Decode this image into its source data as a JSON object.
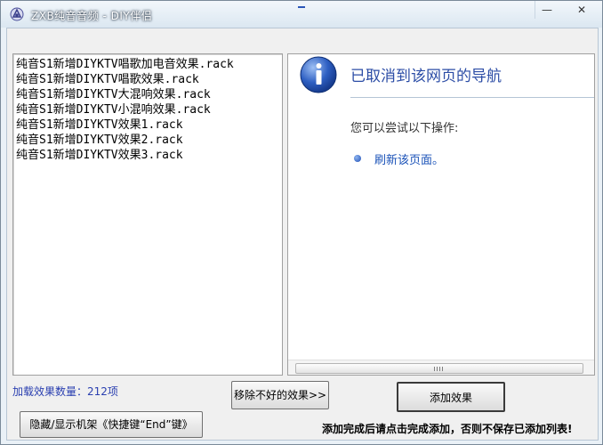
{
  "window": {
    "title": "ZXB纯音音频 - DIY伴侣",
    "minimize_glyph": "—",
    "close_glyph": "✕"
  },
  "effects_list": {
    "items": [
      "纯音S1新增DIYKTV唱歌加电音效果.rack",
      "纯音S1新增DIYKTV唱歌效果.rack",
      "纯音S1新增DIYKTV大混响效果.rack",
      "纯音S1新增DIYKTV小混响效果.rack",
      "纯音S1新增DIYKTV效果1.rack",
      "纯音S1新增DIYKTV效果2.rack",
      "纯音S1新增DIYKTV效果3.rack"
    ]
  },
  "browser_panel": {
    "heading": "已取消到该网页的导航",
    "suggestion": "您可以尝试以下操作:",
    "refresh_link": "刷新该页面。"
  },
  "footer": {
    "count_label": "加载效果数量：212项",
    "remove_button": "移除不好的效果>>",
    "add_button": "添加效果",
    "toggle_rack_button": "隐藏/显示机架《快捷键“End”键》",
    "notice": "添加完成后请点击完成添加，否则不保存已添加列表!"
  },
  "colors": {
    "link": "#1a52b8",
    "heading": "#2c4da6",
    "count_text": "#2a3fb0"
  }
}
